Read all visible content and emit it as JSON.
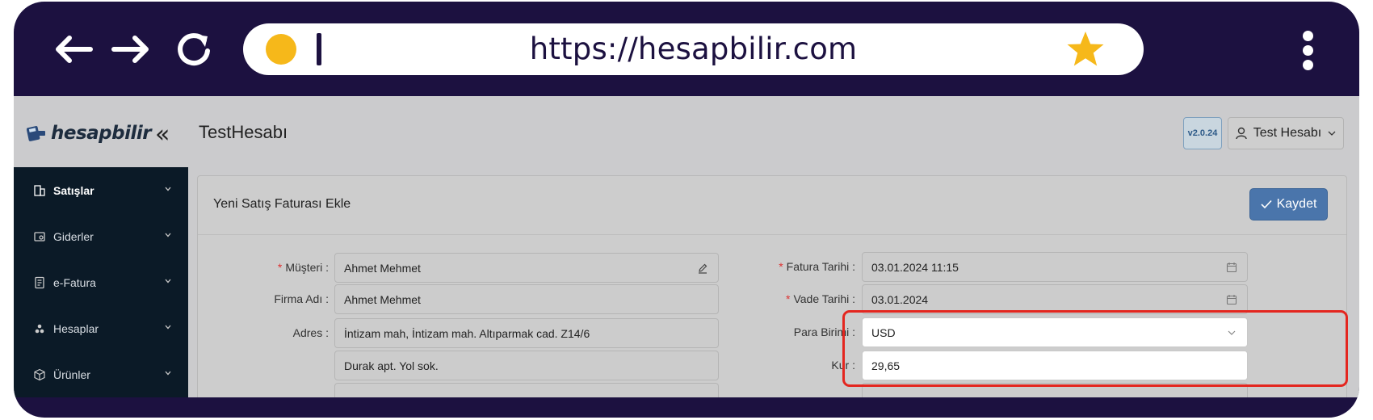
{
  "browser": {
    "url": "https://hesapbilir.com",
    "back_icon": "arrow-left-icon",
    "forward_icon": "arrow-right-icon",
    "reload_icon": "reload-icon",
    "bookmark_icon": "star-icon",
    "menu_icon": "kebab-menu-icon",
    "accent_color": "#f6b81a",
    "frame_color": "#1c1140"
  },
  "app": {
    "logo_text": "hesapbilir",
    "collapse_glyph": "«",
    "title": "TestHesabı",
    "version": "v2.0.24",
    "user_label": "Test Hesabı"
  },
  "sidebar": {
    "items": [
      {
        "label": "Satışlar",
        "icon": "building-icon"
      },
      {
        "label": "Giderler",
        "icon": "expense-icon"
      },
      {
        "label": "e-Fatura",
        "icon": "invoice-icon"
      },
      {
        "label": "Hesaplar",
        "icon": "accounts-icon"
      },
      {
        "label": "Ürünler",
        "icon": "box-icon"
      }
    ]
  },
  "form": {
    "title": "Yeni Satış Faturası Ekle",
    "save_label": "Kaydet",
    "save_color": "#4a75ab",
    "musteri_label": "Müşteri :",
    "musteri_value": "Ahmet Mehmet",
    "firma_label": "Firma Adı :",
    "firma_value": "Ahmet Mehmet",
    "adres_label": "Adres :",
    "adres_line1": "İntizam mah, İntizam mah. Altıparmak cad. Z14/6",
    "adres_line2": "Durak apt. Yol sok.",
    "fatura_tarihi_label": "Fatura Tarihi :",
    "fatura_tarihi_value": "03.01.2024 11:15",
    "vade_tarihi_label": "Vade Tarihi :",
    "vade_tarihi_value": "03.01.2024",
    "para_birimi_label": "Para Birimi :",
    "para_birimi_value": "USD",
    "kur_label": "Kur :",
    "kur_value": "29,65",
    "required_mark": "*"
  },
  "highlight_color": "#e4261f"
}
